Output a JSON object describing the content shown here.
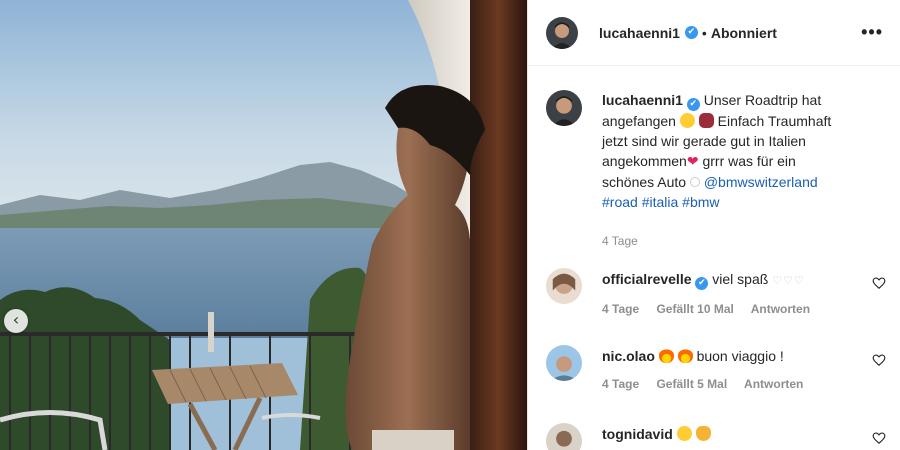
{
  "post": {
    "author": "lucahaenni1",
    "follow_status": "Abonniert",
    "dot": "•",
    "more_icon": "•••",
    "caption": {
      "line1_after_name": "Unser Roadtrip hat",
      "line2": "angefangen",
      "line2_tail": "Einfach Traumhaft",
      "line3": "jetzt sind wir gerade gut in Italien",
      "line4": "angekommen",
      "line4_tail": "grrr was für ein",
      "line5": "schönes Auto",
      "mention": "@bmwswitzerland",
      "hashtags": "#road #italia #bmw",
      "time": "4 Tage"
    }
  },
  "comments": [
    {
      "username": "officialrevelle",
      "verified": true,
      "text": "viel spaß",
      "time": "4 Tage",
      "likes": "Gefällt 10 Mal",
      "reply": "Antworten"
    },
    {
      "username": "nic.olao",
      "verified": false,
      "text": "buon viaggio !",
      "time": "4 Tage",
      "likes": "Gefällt 5 Mal",
      "reply": "Antworten"
    },
    {
      "username": "tognidavid",
      "verified": false,
      "text": "",
      "time": "",
      "likes": "",
      "reply": ""
    }
  ],
  "colors": {
    "verified": "#3897f0",
    "link": "#1a5fb4",
    "muted": "#8e8e8e"
  },
  "icons": {
    "verified": "✔",
    "prev": "‹",
    "heart": "heart-outline-icon"
  }
}
